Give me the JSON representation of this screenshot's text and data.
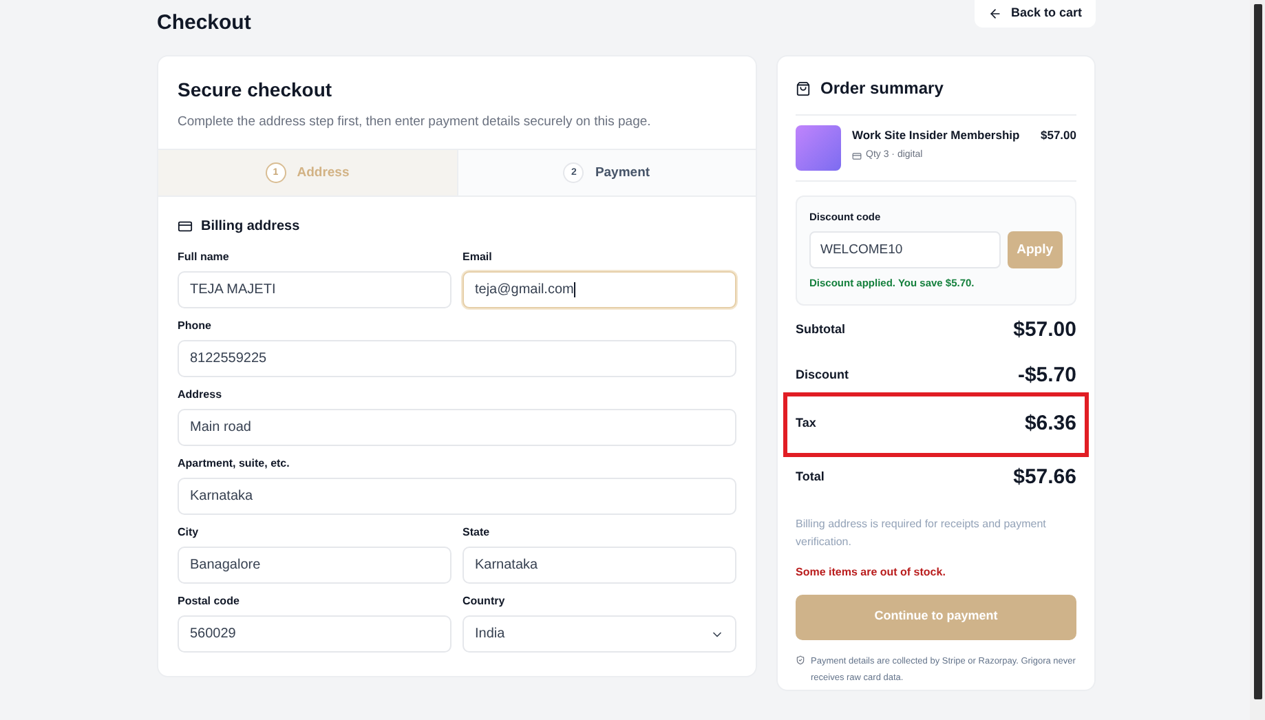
{
  "page": {
    "title": "Checkout",
    "back_button": "Back to cart"
  },
  "checkout": {
    "title": "Secure checkout",
    "subtitle": "Complete the address step first, then enter payment details securely on this page.",
    "steps": [
      {
        "number": "1",
        "label": "Address",
        "selected": true
      },
      {
        "number": "2",
        "label": "Payment",
        "selected": false
      }
    ],
    "section_title": "Billing address",
    "rows": [
      [
        {
          "label": "Full name",
          "kind": "text",
          "value": "TEJA MAJETI",
          "focused": false
        },
        {
          "label": "Email",
          "kind": "text",
          "value": "teja@gmail.com",
          "focused": true
        }
      ],
      [
        {
          "label": "Phone",
          "kind": "text",
          "value": "8122559225",
          "focused": false
        }
      ],
      [
        {
          "label": "Address",
          "kind": "text",
          "value": "Main road",
          "focused": false
        }
      ],
      [
        {
          "label": "Apartment, suite, etc.",
          "kind": "text",
          "value": "Karnataka",
          "focused": false
        }
      ],
      [
        {
          "label": "City",
          "kind": "text",
          "value": "Banagalore",
          "focused": false
        },
        {
          "label": "State",
          "kind": "text",
          "value": "Karnataka",
          "focused": false
        }
      ],
      [
        {
          "label": "Postal code",
          "kind": "text",
          "value": "560029",
          "focused": false
        },
        {
          "label": "Country",
          "kind": "select",
          "value": "India",
          "focused": false
        }
      ]
    ]
  },
  "summary": {
    "title": "Order summary",
    "item": {
      "name": "Work Site Insider Membership",
      "meta": "Qty 3 · digital",
      "price": "$57.00"
    },
    "discount": {
      "label": "Discount code",
      "value": "WELCOME10",
      "button": "Apply",
      "message": "Discount applied. You save $5.70."
    },
    "totals": [
      {
        "label": "Subtotal",
        "value": "$57.00",
        "highlighted": false
      },
      {
        "label": "Discount",
        "value": "-$5.70",
        "highlighted": false
      },
      {
        "label": "Tax",
        "value": "$6.36",
        "highlighted": true
      },
      {
        "label": "Total",
        "value": "$57.66",
        "highlighted": false
      }
    ],
    "note": "Billing address is required for receipts and payment verification.",
    "error": "Some items are out of stock.",
    "continue_button": {
      "label": "Continue to payment",
      "disabled": true
    },
    "security_note": "Payment details are collected by Stripe or Razorpay. Grigora never receives raw card data."
  }
}
